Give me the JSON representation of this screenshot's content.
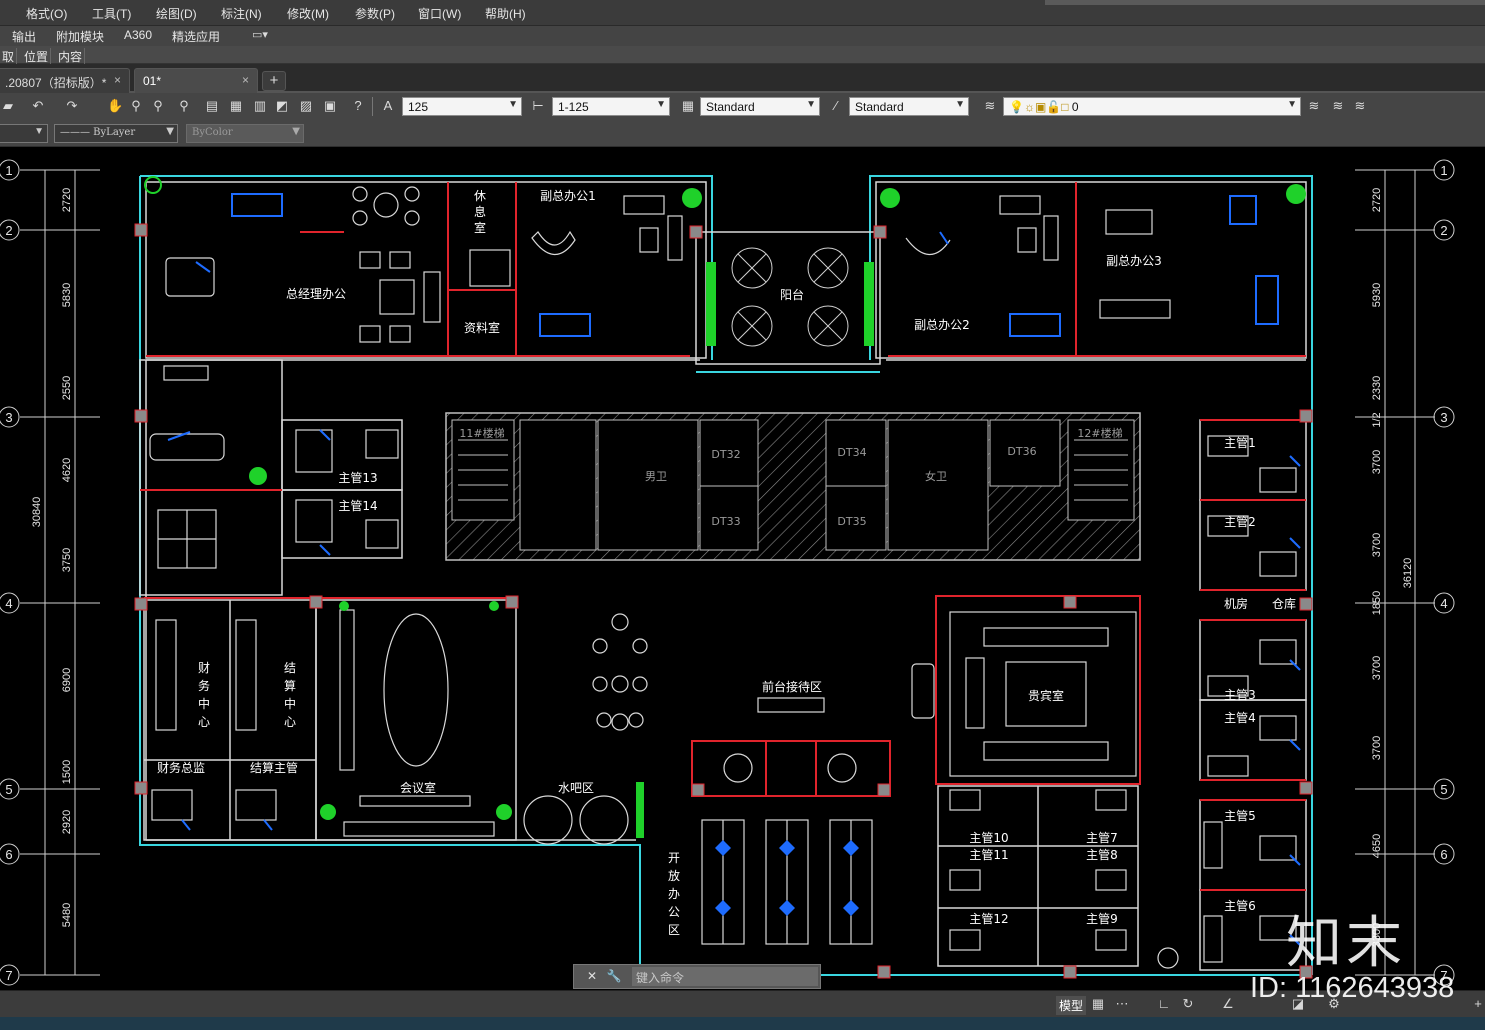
{
  "menubar": {
    "items": [
      "格式(O)",
      "工具(T)",
      "绘图(D)",
      "标注(N)",
      "修改(M)",
      "参数(P)",
      "窗口(W)",
      "帮助(H)"
    ]
  },
  "ribbon_tabs": {
    "items": [
      "输出",
      "附加模块",
      "A360",
      "精选应用"
    ]
  },
  "ribbon_panel": {
    "items": [
      "取",
      "位置",
      "内容"
    ]
  },
  "doc_tabs": [
    {
      "label": ".20807（招标版）*",
      "close": "×"
    },
    {
      "label": "01*",
      "close": "×"
    }
  ],
  "new_tab": "+",
  "toolbar1": {
    "dim_style_value": "125",
    "scale_value": "1-125",
    "text_style_value": "Standard",
    "table_style_value": "Standard",
    "layer_value": "0"
  },
  "toolbar2": {
    "linetype_value": "——— ByLayer",
    "lineweight_value": "ByColor"
  },
  "drawing": {
    "grid_rows_left": [
      "1",
      "2",
      "3",
      "4",
      "5",
      "6",
      "7"
    ],
    "grid_rows_right": [
      "1",
      "2",
      "3",
      "4",
      "5",
      "6",
      "7"
    ],
    "dims_left": [
      "2720",
      "5830",
      "2550",
      "4620",
      "3750",
      "6900",
      "1500",
      "2920",
      "5480"
    ],
    "dim_total_left": "30840",
    "dims_right": [
      "2720",
      "5930",
      "2330",
      "1/2",
      "3700",
      "3700",
      "1850",
      "3700",
      "3700",
      "4650",
      "3300"
    ],
    "dim_total_right": "36120",
    "rooms": {
      "gm_office": "总经理办公",
      "rest_room_1": "休",
      "rest_room_2": "息",
      "rest_room_3": "室",
      "archive": "资料室",
      "vp1": "副总办公1",
      "balcony": "阳台",
      "vp2": "副总办公2",
      "vp3": "副总办公3",
      "stair11": "11#楼梯",
      "stair12": "12#楼梯",
      "dt32": "DT32",
      "dt33": "DT33",
      "dt34": "DT34",
      "dt35": "DT35",
      "dt36": "DT36",
      "male_wc": "男卫",
      "female_wc": "女卫",
      "sup13": "主管13",
      "sup14": "主管14",
      "finance_center": [
        "财",
        "务",
        "中",
        "心"
      ],
      "settlement_center": [
        "结",
        "算",
        "中",
        "心"
      ],
      "finance_director": "财务总监",
      "settlement_sup": "结算主管",
      "meeting_room": "会议室",
      "water_bar": "水吧区",
      "reception": "前台接待区",
      "vip_room": "贵宾室",
      "open_office": [
        "开",
        "放",
        "办",
        "公",
        "区"
      ],
      "machine_room": "机房",
      "warehouse": "仓库",
      "sup1": "主管1",
      "sup2": "主管2",
      "sup3": "主管3",
      "sup4": "主管4",
      "sup5": "主管5",
      "sup6": "主管6",
      "sup7": "主管7",
      "sup8": "主管8",
      "sup9": "主管9",
      "sup10": "主管10",
      "sup11": "主管11",
      "sup12": "主管12"
    }
  },
  "cmdline": {
    "placeholder": "键入命令"
  },
  "statusbar": {
    "model": "模型"
  },
  "watermark": {
    "brand": "知末",
    "id": "ID: 1162643938"
  },
  "colors": {
    "wall_red": "#e0242c",
    "window_cyan": "#3ad6e0",
    "furniture_white": "#d9d9d9",
    "furniture_blue": "#1e6cff",
    "plant_green": "#1fd12a",
    "hatch_gray": "#8a8a8a"
  }
}
